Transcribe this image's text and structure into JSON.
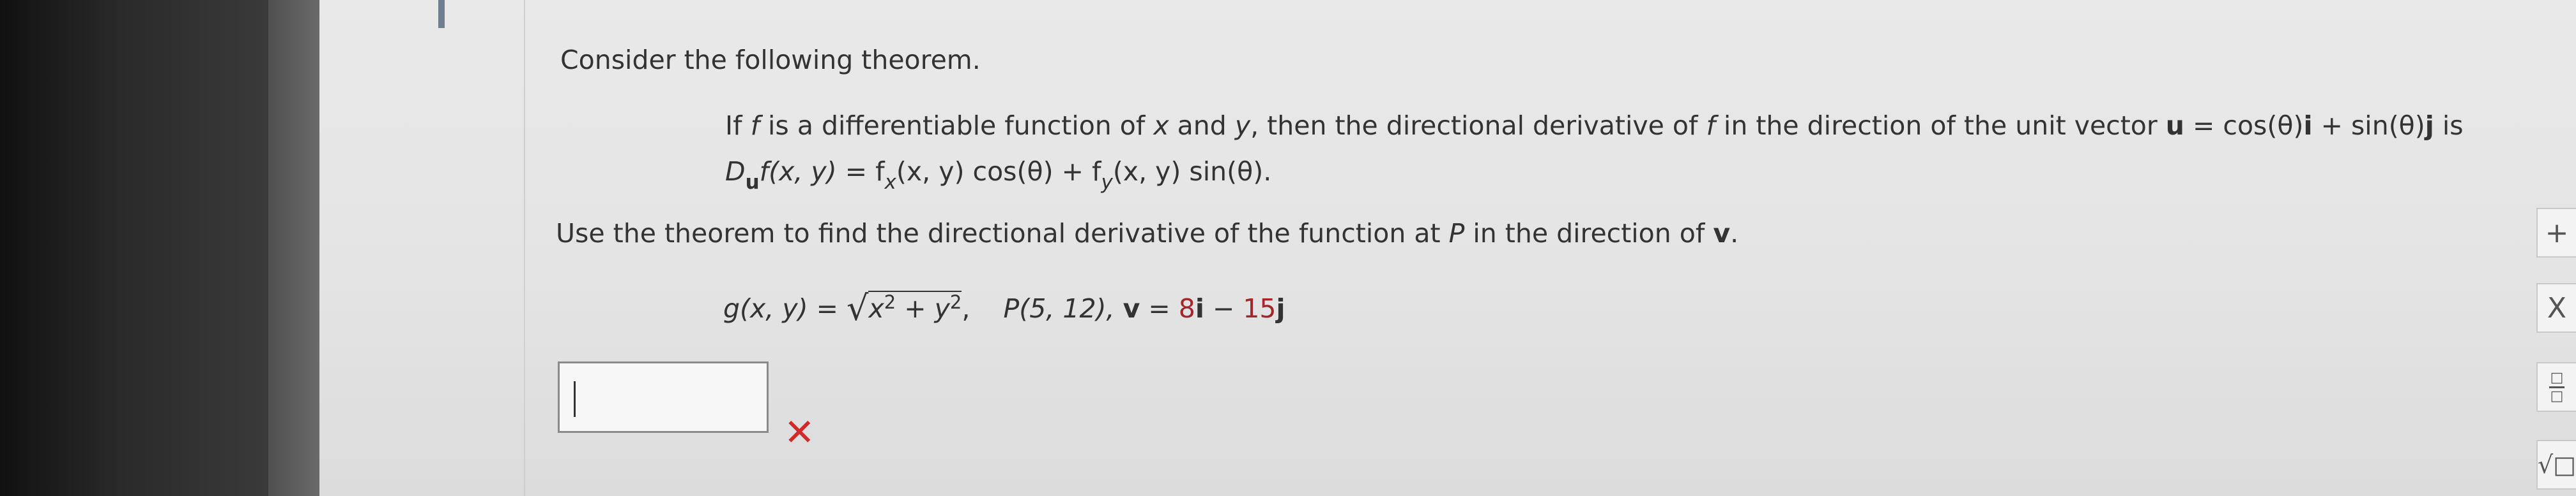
{
  "theorem_intro": "Consider the following theorem.",
  "theorem_statement": {
    "p1": "If ",
    "f1": "f",
    "p2": " is a differentiable function of ",
    "x": "x",
    "p3": " and ",
    "y": "y",
    "p4": ", then the directional derivative of ",
    "f2": "f",
    "p5": " in the direction of the unit vector ",
    "u": "u",
    "p6": " = cos(θ)",
    "i": "i",
    "p7": " + sin(θ)",
    "j": "j",
    "p8": " is"
  },
  "theorem_formula": {
    "D": "D",
    "u_sub": "u",
    "f_xy": "f(x, y)",
    "eq": " = f",
    "x_sub": "x",
    "part2": "(x, y) cos(θ) + f",
    "y_sub": "y",
    "part3": "(x, y) sin(θ)."
  },
  "instruction": {
    "text": "Use the theorem to find the directional derivative of the function at ",
    "P": "P",
    "mid": " in the direction of ",
    "v": "v",
    "end": "."
  },
  "function_line": {
    "g": "g(x, y) = ",
    "x": "x",
    "exp1": "2",
    "plus": " + ",
    "y": "y",
    "exp2": "2",
    "comma": ",",
    "point": "P(5, 12), ",
    "v": "v",
    "eq": " = ",
    "n8": "8",
    "i": "i",
    "minus": " − ",
    "n15": "15",
    "j": "j"
  },
  "answer": {
    "value": ""
  },
  "tools": {
    "plus": "+",
    "times": "X",
    "frac_num": "□",
    "frac_den": "□",
    "sqrt": "√□"
  },
  "colors": {
    "answer_number_color": "#a3262a",
    "wrong_icon": "#d02a2a"
  }
}
